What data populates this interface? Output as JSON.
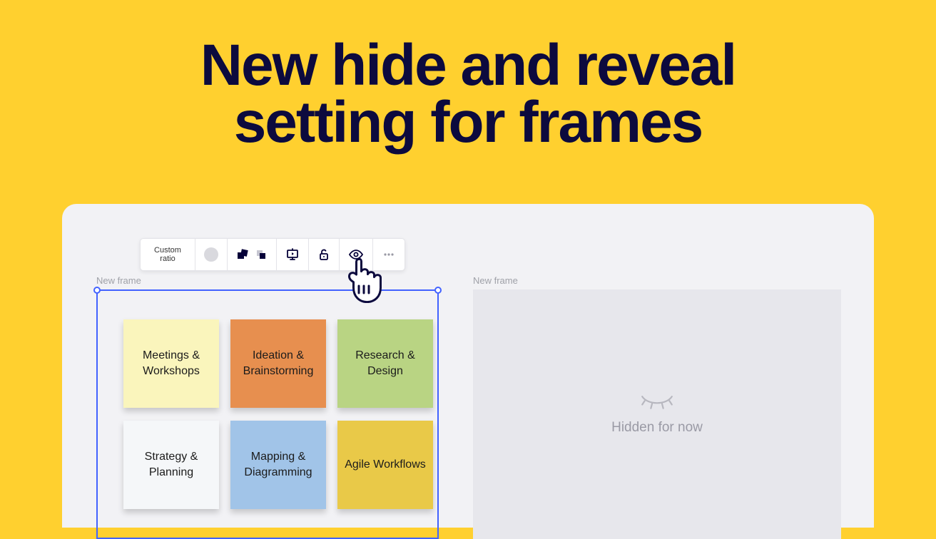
{
  "headline": {
    "line1": "New hide and reveal",
    "line2": "setting for frames"
  },
  "toolbar": {
    "ratio_line1": "Custom",
    "ratio_line2": "ratio"
  },
  "frame1": {
    "label": "New frame",
    "stickies": [
      {
        "text": "Meetings & Workshops",
        "color": "#FAF5BC"
      },
      {
        "text": "Ideation & Brainstorming",
        "color": "#E78F4F"
      },
      {
        "text": "Research & Design",
        "color": "#B9D483"
      },
      {
        "text": "Strategy & Planning",
        "color": "#F5F7F9"
      },
      {
        "text": "Mapping & Diagramming",
        "color": "#A1C4E8"
      },
      {
        "text": "Agile Workflows",
        "color": "#E9C948"
      }
    ]
  },
  "frame2": {
    "label": "New frame",
    "hidden_text": "Hidden for now"
  }
}
